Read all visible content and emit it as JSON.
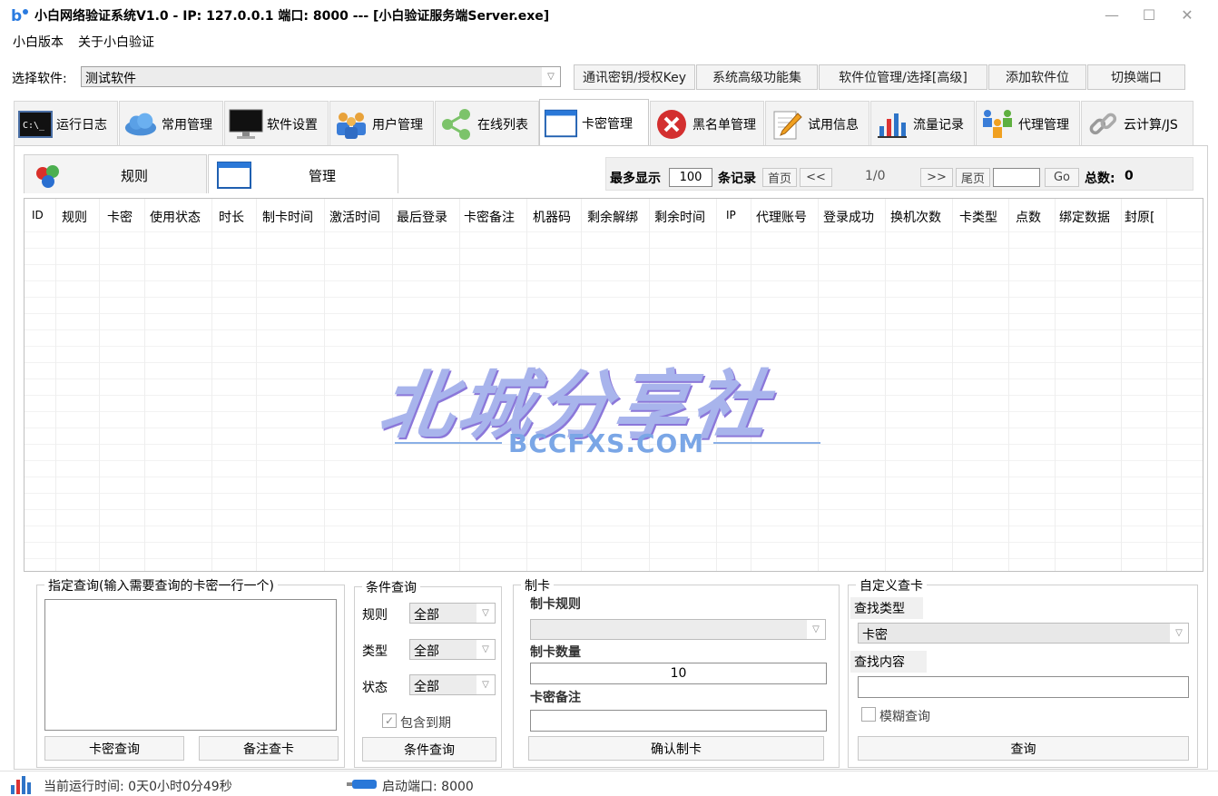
{
  "window": {
    "title": "小白网络验证系统V1.0 - IP: 127.0.0.1 端口: 8000   ---   [小白验证服务端Server.exe]",
    "minimize": "—",
    "maximize": "☐",
    "close": "✕"
  },
  "menu": {
    "items": [
      "小白版本",
      "关于小白验证"
    ]
  },
  "software": {
    "label": "选择软件:",
    "selected": "测试软件"
  },
  "toolbar_buttons": [
    "通讯密钥/授权Key",
    "系统高级功能集",
    "软件位管理/选择[高级]",
    "添加软件位",
    "切换端口"
  ],
  "main_tabs": [
    {
      "label": "运行日志",
      "icon": "console-icon"
    },
    {
      "label": "常用管理",
      "icon": "cloud-icon"
    },
    {
      "label": "软件设置",
      "icon": "monitor-icon"
    },
    {
      "label": "用户管理",
      "icon": "users-icon"
    },
    {
      "label": "在线列表",
      "icon": "share-icon"
    },
    {
      "label": "卡密管理",
      "icon": "window-icon"
    },
    {
      "label": "黑名单管理",
      "icon": "block-icon"
    },
    {
      "label": "试用信息",
      "icon": "edit-icon"
    },
    {
      "label": "流量记录",
      "icon": "bar-chart-icon"
    },
    {
      "label": "代理管理",
      "icon": "agents-icon"
    },
    {
      "label": "云计算/JS",
      "icon": "link-icon"
    }
  ],
  "active_main_tab": "卡密管理",
  "sub_tabs": [
    {
      "label": "规则",
      "icon": "rules-icon"
    },
    {
      "label": "管理",
      "icon": "window-icon"
    }
  ],
  "pager": {
    "max_show_label": "最多显示",
    "max_show_value": "100",
    "records_label": "条记录",
    "first": "首页",
    "prev": "<<",
    "page_info": "1/0",
    "next": ">>",
    "last": "尾页",
    "goto_value": "",
    "go": "Go",
    "total_label": "总数:",
    "total_value": "0"
  },
  "table": {
    "columns": [
      "ID",
      "规则",
      "卡密",
      "使用状态",
      "时长",
      "制卡时间",
      "激活时间",
      "最后登录",
      "卡密备注",
      "机器码",
      "剩余解绑",
      "剩余时间",
      "IP",
      "代理账号",
      "登录成功",
      "换机次数",
      "卡类型",
      "点数",
      "绑定数据",
      "封原["
    ]
  },
  "watermark": {
    "main": "北城分享社",
    "sub": "BCCFXS.COM"
  },
  "query_group": {
    "title": "指定查询(输入需要查询的卡密一行一个)",
    "btn_card_query": "卡密查询",
    "btn_note_query": "备注查卡"
  },
  "condition_group": {
    "title": "条件查询",
    "rule_label": "规则",
    "rule_value": "全部",
    "type_label": "类型",
    "type_value": "全部",
    "status_label": "状态",
    "status_value": "全部",
    "include_expired": "包含到期",
    "button": "条件查询"
  },
  "make_card_group": {
    "title": "制卡",
    "rule_label": "制卡规则",
    "rule_value": "",
    "count_label": "制卡数量",
    "count_value": "10",
    "note_label": "卡密备注",
    "note_value": "",
    "button": "确认制卡"
  },
  "custom_group": {
    "title": "自定义查卡",
    "type_label": "查找类型",
    "type_value": "卡密",
    "content_label": "查找内容",
    "content_value": "",
    "fuzzy": "模糊查询",
    "button": "查询"
  },
  "status": {
    "runtime": "当前运行时间: 0天0小时0分49秒",
    "port": "启动端口: 8000"
  }
}
